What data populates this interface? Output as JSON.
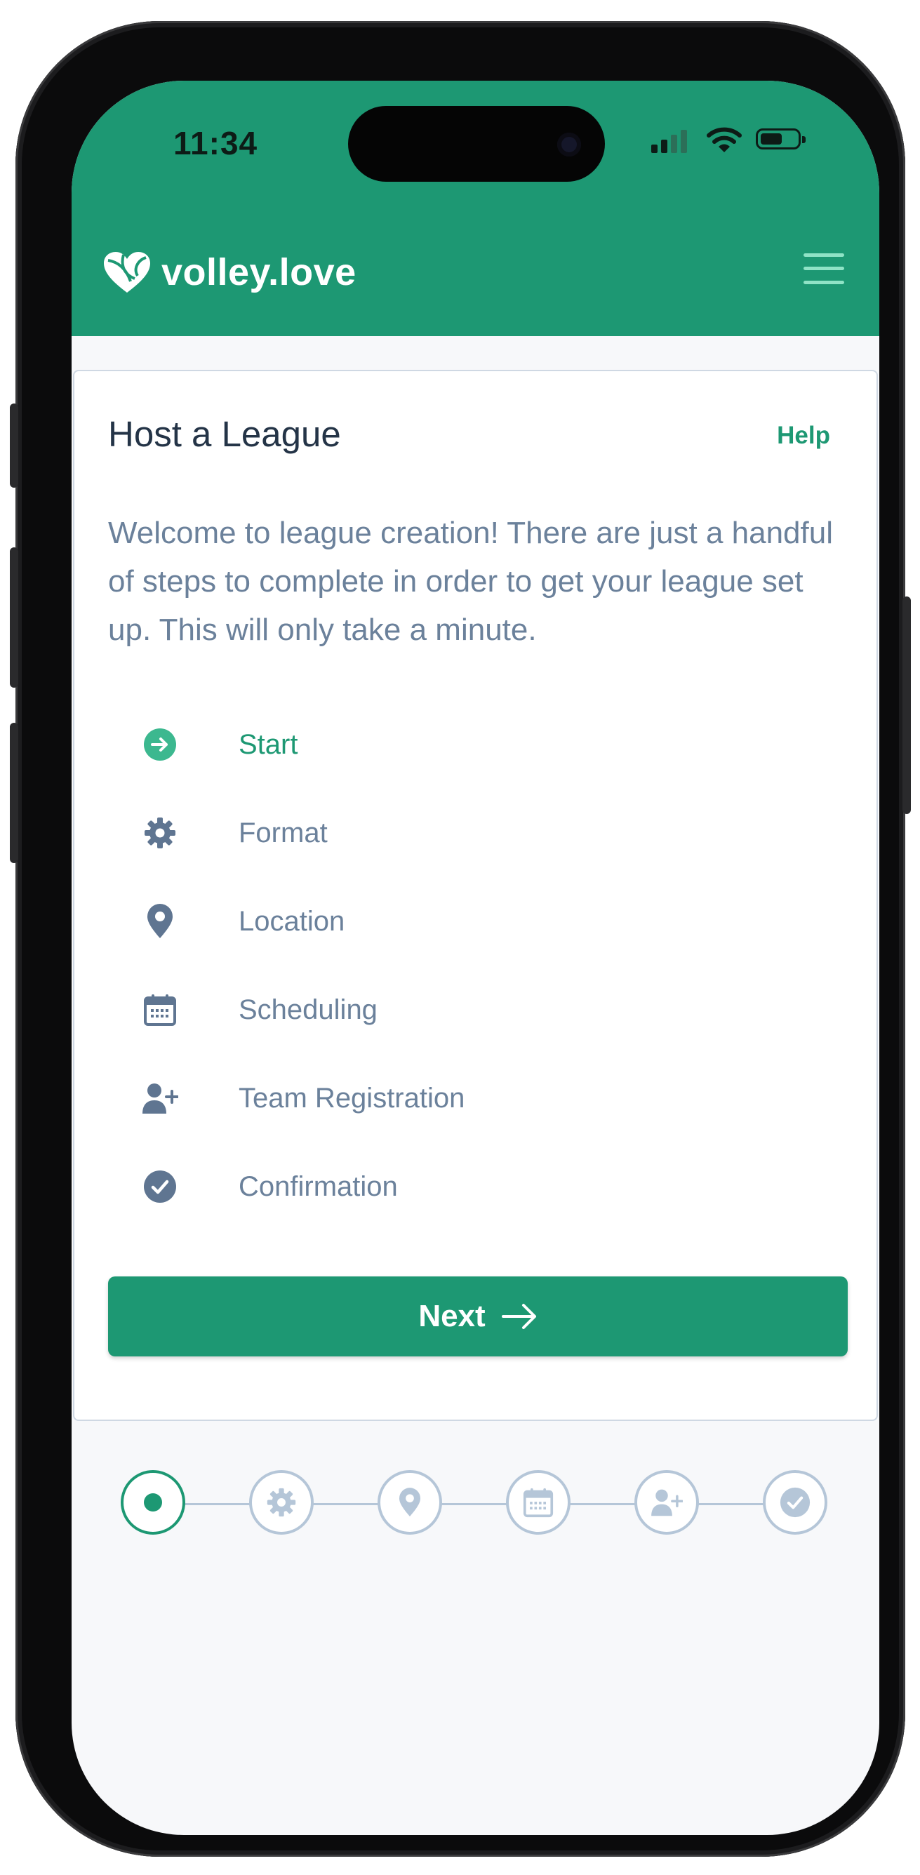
{
  "status_bar": {
    "time": "11:34"
  },
  "header": {
    "brand": "volley.love",
    "menu_icon": "hamburger-menu-icon"
  },
  "card": {
    "title": "Host a League",
    "help_label": "Help",
    "intro": "Welcome to league creation! There are just a handful of steps to complete in order to get your league set up. This will only take a minute."
  },
  "steps": [
    {
      "label": "Start",
      "icon": "arrow-right-circle-icon",
      "active": true
    },
    {
      "label": "Format",
      "icon": "gear-icon",
      "active": false
    },
    {
      "label": "Location",
      "icon": "map-pin-icon",
      "active": false
    },
    {
      "label": "Scheduling",
      "icon": "calendar-icon",
      "active": false
    },
    {
      "label": "Team Registration",
      "icon": "user-plus-icon",
      "active": false
    },
    {
      "label": "Confirmation",
      "icon": "check-circle-icon",
      "active": false
    }
  ],
  "next_button": {
    "label": "Next",
    "icon": "arrow-right-icon"
  },
  "progress": {
    "current_step": 1,
    "total_steps": 6
  },
  "colors": {
    "brand": "#1d9873",
    "muted": "#6b819b",
    "inactive": "#b5c6d8",
    "title": "#243447"
  }
}
